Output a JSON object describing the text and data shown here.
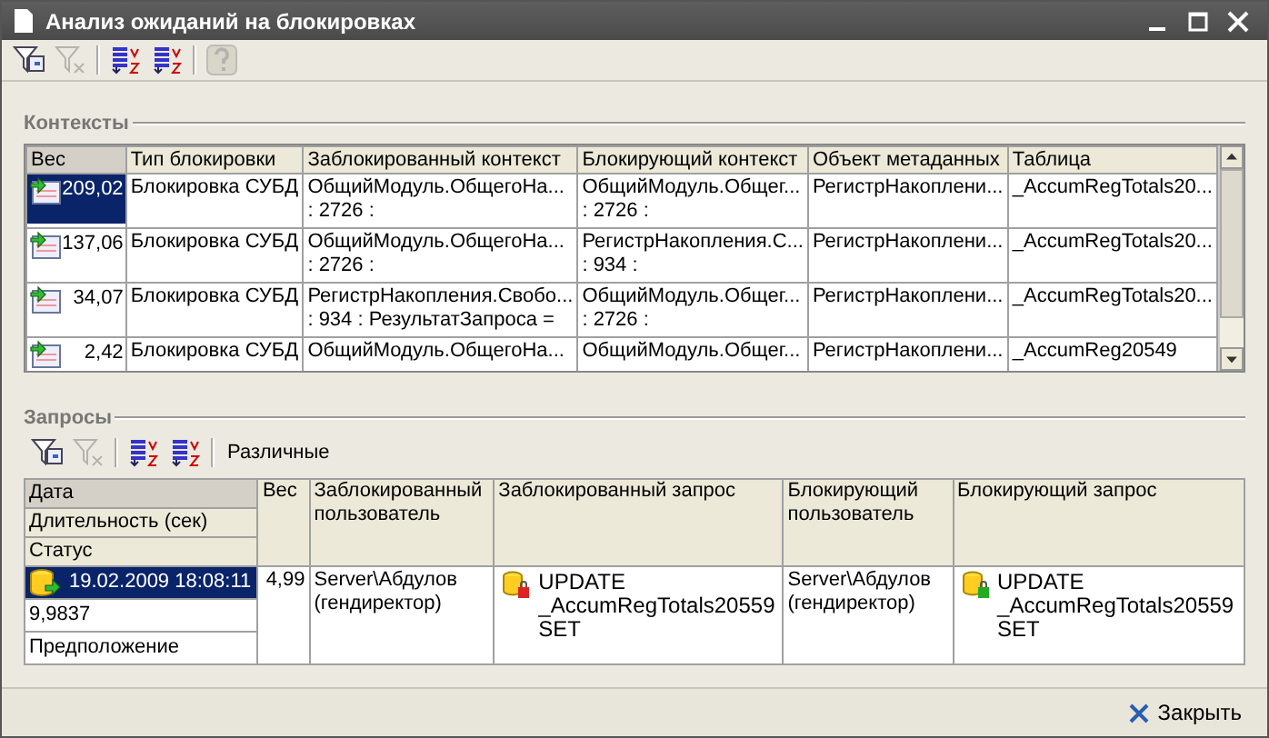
{
  "window": {
    "title": "Анализ ожиданий на блокировках"
  },
  "toolbar": [
    {
      "kind": "filter",
      "disabled": false
    },
    {
      "kind": "filter-clear",
      "disabled": true
    },
    {
      "kind": "sort-asc",
      "disabled": false
    },
    {
      "kind": "sort-desc",
      "disabled": false
    },
    {
      "kind": "help",
      "disabled": true
    }
  ],
  "contexts": {
    "title": "Контексты",
    "columns": [
      "Вес",
      "Тип блокировки",
      "Заблокированный контекст",
      "Блокирующий контекст",
      "Объект метаданных",
      "Таблица"
    ],
    "rows": [
      {
        "selected": true,
        "cells": [
          [
            "209,02"
          ],
          [
            "Блокировка СУБД"
          ],
          [
            "ОбщийМодуль.ОбщегоНа...",
            ": 2726 :"
          ],
          [
            "ОбщийМодуль.Общег...",
            ": 2726 :"
          ],
          [
            "РегистрНакоплени..."
          ],
          [
            "_AccumRegTotals20..."
          ]
        ]
      },
      {
        "selected": false,
        "cells": [
          [
            "137,06"
          ],
          [
            "Блокировка СУБД"
          ],
          [
            "ОбщийМодуль.ОбщегоНа...",
            ": 2726 :"
          ],
          [
            "РегистрНакопления.С...",
            ": 934 :"
          ],
          [
            "РегистрНакоплени..."
          ],
          [
            "_AccumRegTotals20..."
          ]
        ]
      },
      {
        "selected": false,
        "cells": [
          [
            "34,07"
          ],
          [
            "Блокировка СУБД"
          ],
          [
            "РегистрНакопления.Свобо...",
            ": 934 : РезультатЗапроса ="
          ],
          [
            "ОбщийМодуль.Общег...",
            ": 2726 :"
          ],
          [
            "РегистрНакоплени..."
          ],
          [
            "_AccumRegTotals20..."
          ]
        ]
      },
      {
        "selected": false,
        "cells": [
          [
            "2,42"
          ],
          [
            "Блокировка СУБД"
          ],
          [
            "ОбщийМодуль.ОбщегоНа..."
          ],
          [
            "ОбщийМодуль.Общег..."
          ],
          [
            "РегистрНакоплени..."
          ],
          [
            "_AccumReg20549"
          ]
        ]
      }
    ]
  },
  "requests": {
    "title": "Запросы",
    "toolbar": [
      {
        "kind": "filter",
        "disabled": false
      },
      {
        "kind": "filter-clear",
        "disabled": true
      },
      {
        "kind": "sort-asc",
        "disabled": false
      },
      {
        "kind": "sort-desc",
        "disabled": false
      }
    ],
    "toolbar_label": "Различные",
    "stack_headers": [
      "Дата",
      "Длительность (сек)",
      "Статус"
    ],
    "columns": [
      "Вес",
      "Заблокированный пользователь",
      "Заблокированный запрос",
      "Блокирующий пользователь",
      "Блокирующий запрос"
    ],
    "rows": [
      {
        "selected": true,
        "date": "19.02.2009 18:08:11",
        "duration": "9,9837",
        "status": "Предположение",
        "cells": [
          {
            "kind": "number",
            "lines": [
              "4,99"
            ]
          },
          {
            "kind": "text",
            "lines": [
              "Server\\Абдулов",
              "(гендиректор)"
            ]
          },
          {
            "kind": "blocked-query",
            "lines": [
              "UPDATE",
              "_AccumRegTotals20559",
              "SET"
            ]
          },
          {
            "kind": "text",
            "lines": [
              "Server\\Абдулов",
              "(гендиректор)"
            ]
          },
          {
            "kind": "blocking-query",
            "lines": [
              "UPDATE",
              "_AccumRegTotals20559",
              "SET"
            ]
          }
        ]
      }
    ]
  },
  "footer": {
    "close_button": "Закрыть"
  }
}
